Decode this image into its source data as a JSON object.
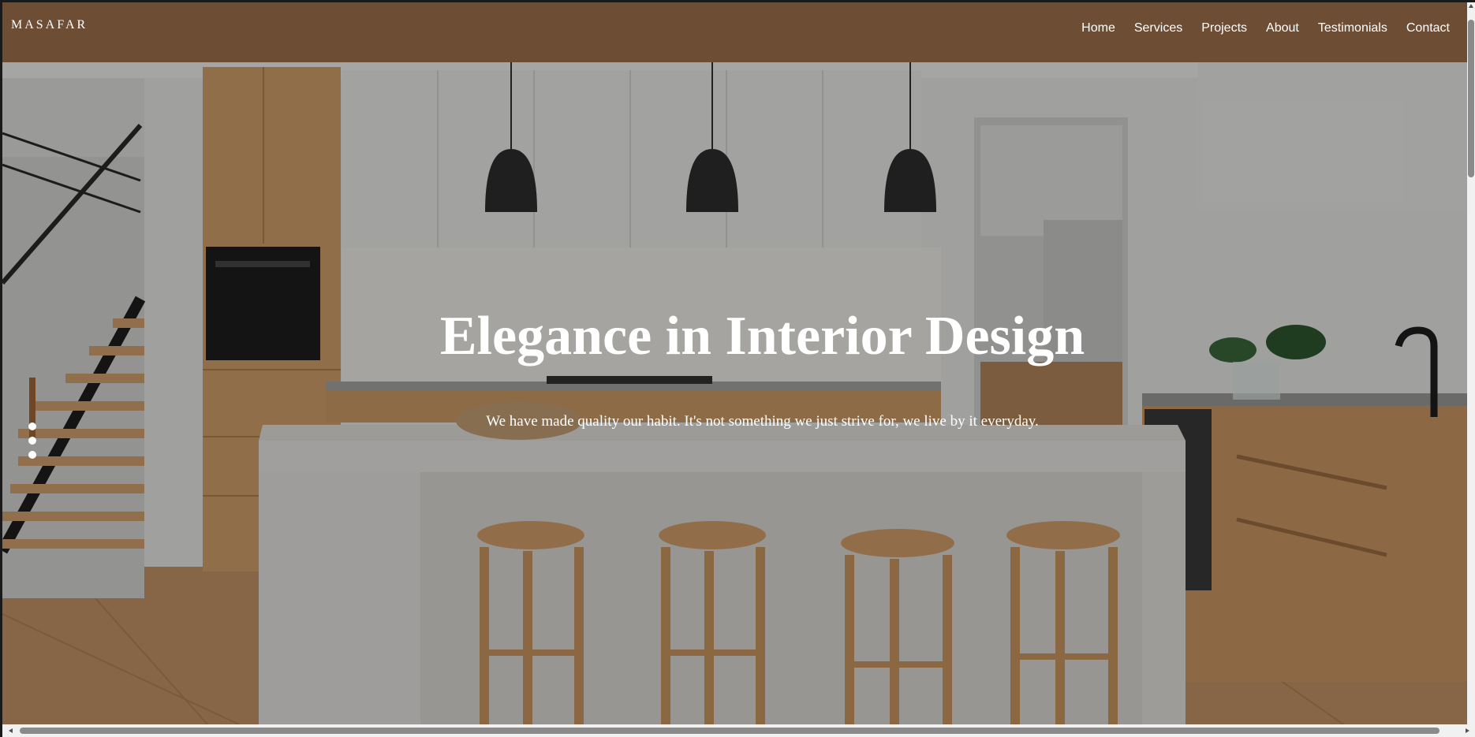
{
  "header": {
    "brand": "MASAFAR",
    "nav": [
      {
        "label": "Home"
      },
      {
        "label": "Services"
      },
      {
        "label": "Projects"
      },
      {
        "label": "About"
      },
      {
        "label": "Testimonials"
      },
      {
        "label": "Contact"
      }
    ]
  },
  "hero": {
    "title": "Elegance in Interior Design",
    "subtitle": "We have made quality our habit. It's not something we just strive for, we live by it everyday.",
    "slides": 3,
    "active_slide": 1
  },
  "colors": {
    "header_bg": "#6d4e35",
    "text": "#ffffff",
    "overlay": "rgba(0,0,0,0.33)"
  }
}
